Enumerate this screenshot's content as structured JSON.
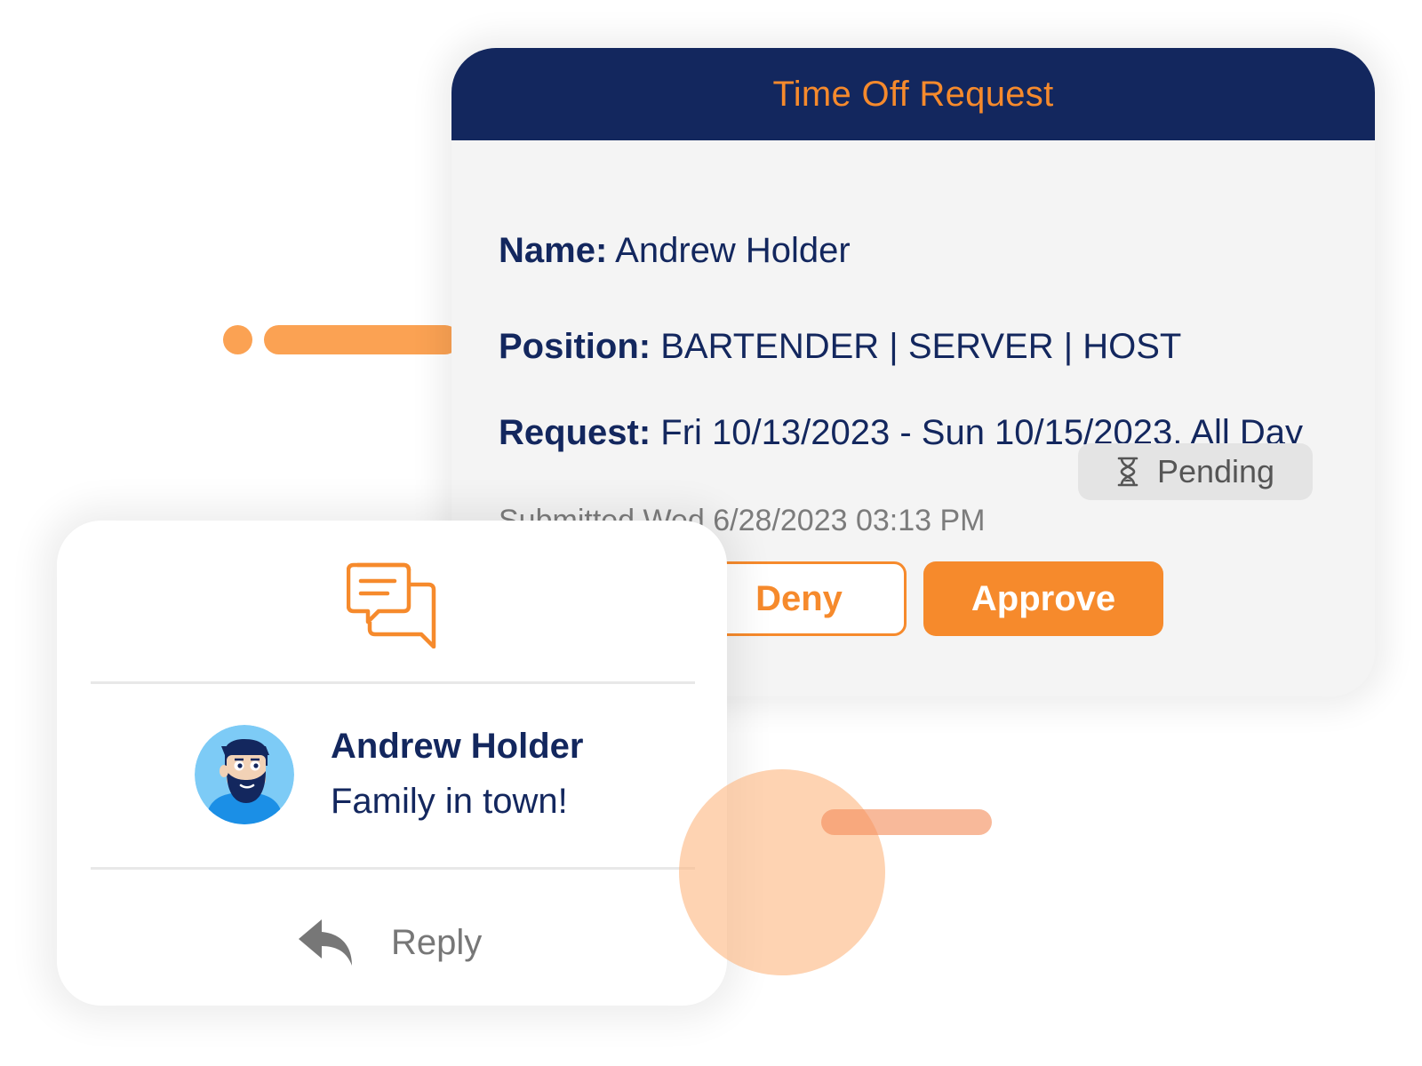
{
  "request_card": {
    "title": "Time Off Request",
    "name_label": "Name:",
    "name_value": "Andrew Holder",
    "position_label": "Position:",
    "position_value": "BARTENDER | SERVER | HOST",
    "request_label": "Request:",
    "request_value": "Fri 10/13/2023 - Sun 10/15/2023, All Day",
    "submitted": "Submitted Wed 6/28/2023 03:13 PM",
    "status": "Pending",
    "status_icon": "hourglass-icon",
    "deny_label": "Deny",
    "approve_label": "Approve"
  },
  "message_card": {
    "header_icon": "chat-bubbles-icon",
    "sender": "Andrew Holder",
    "message": "Family in town!",
    "avatar_icon": "bearded-man-avatar",
    "reply_icon": "reply-arrow-icon",
    "reply_label": "Reply"
  },
  "colors": {
    "navy": "#13275e",
    "orange": "#f68a2c",
    "card_bg": "#f4f4f4",
    "badge_bg": "#e4e4e4",
    "muted_text": "#7c7c7c",
    "avatar_bg": "#7dcbf6"
  }
}
